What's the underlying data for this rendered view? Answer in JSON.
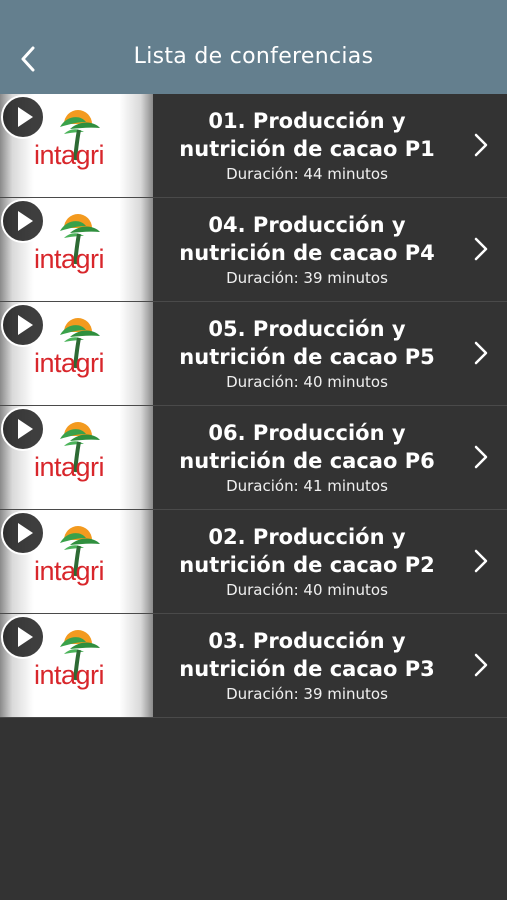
{
  "navbar": {
    "title": "Lista de conferencias",
    "back_icon": "chevron-left-icon",
    "background": "#647f8e"
  },
  "thumbnail": {
    "logo_text": "intagri",
    "logo_color": "#d8262b",
    "play_icon": "play-icon"
  },
  "conferences": [
    {
      "title_line1": "01. Producción y",
      "title_line2": "nutrición de cacao P1",
      "duration": "Duración: 44 minutos"
    },
    {
      "title_line1": "04. Producción y",
      "title_line2": "nutrición de cacao P4",
      "duration": "Duración: 39 minutos"
    },
    {
      "title_line1": "05. Producción y",
      "title_line2": "nutrición de cacao P5",
      "duration": "Duración: 40 minutos"
    },
    {
      "title_line1": "06. Producción y",
      "title_line2": "nutrición de cacao P6",
      "duration": "Duración: 41 minutos"
    },
    {
      "title_line1": "02. Producción y",
      "title_line2": "nutrición de cacao P2",
      "duration": "Duración: 40 minutos"
    },
    {
      "title_line1": "03. Producción y",
      "title_line2": "nutrición de cacao P3",
      "duration": "Duración: 39 minutos"
    }
  ]
}
